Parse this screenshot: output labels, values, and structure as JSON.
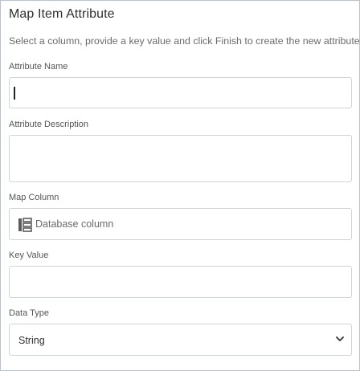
{
  "dialog": {
    "title": "Map Item Attribute",
    "subtitle": "Select a column, provide a key value and click Finish to create the new attribute"
  },
  "fields": {
    "attribute_name": {
      "label": "Attribute Name",
      "value": ""
    },
    "attribute_description": {
      "label": "Attribute Description",
      "value": ""
    },
    "map_column": {
      "label": "Map Column",
      "placeholder": "Database column",
      "icon": "database-column-icon"
    },
    "key_value": {
      "label": "Key Value",
      "value": ""
    },
    "data_type": {
      "label": "Data Type",
      "selected": "String",
      "icon": "chevron-down-icon"
    }
  }
}
